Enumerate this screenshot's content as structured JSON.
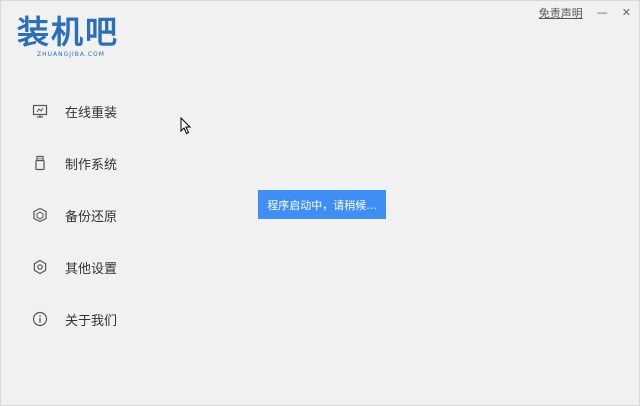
{
  "logo": {
    "title": "装机吧",
    "sub": "ZHUANGJIBA.COM"
  },
  "topbar": {
    "disclaimer": "免责声明",
    "minimize": "—",
    "close": "✕"
  },
  "sidebar": {
    "items": [
      {
        "label": "在线重装",
        "icon": "monitor-icon"
      },
      {
        "label": "制作系统",
        "icon": "usb-icon"
      },
      {
        "label": "备份还原",
        "icon": "backup-icon"
      },
      {
        "label": "其他设置",
        "icon": "gear-icon"
      },
      {
        "label": "关于我们",
        "icon": "info-icon"
      }
    ]
  },
  "toast": {
    "text": "程序启动中，请稍候..."
  },
  "colors": {
    "accent": "#3f8ef4",
    "brand": "#2b6fb8",
    "background": "#f1f1f1"
  }
}
